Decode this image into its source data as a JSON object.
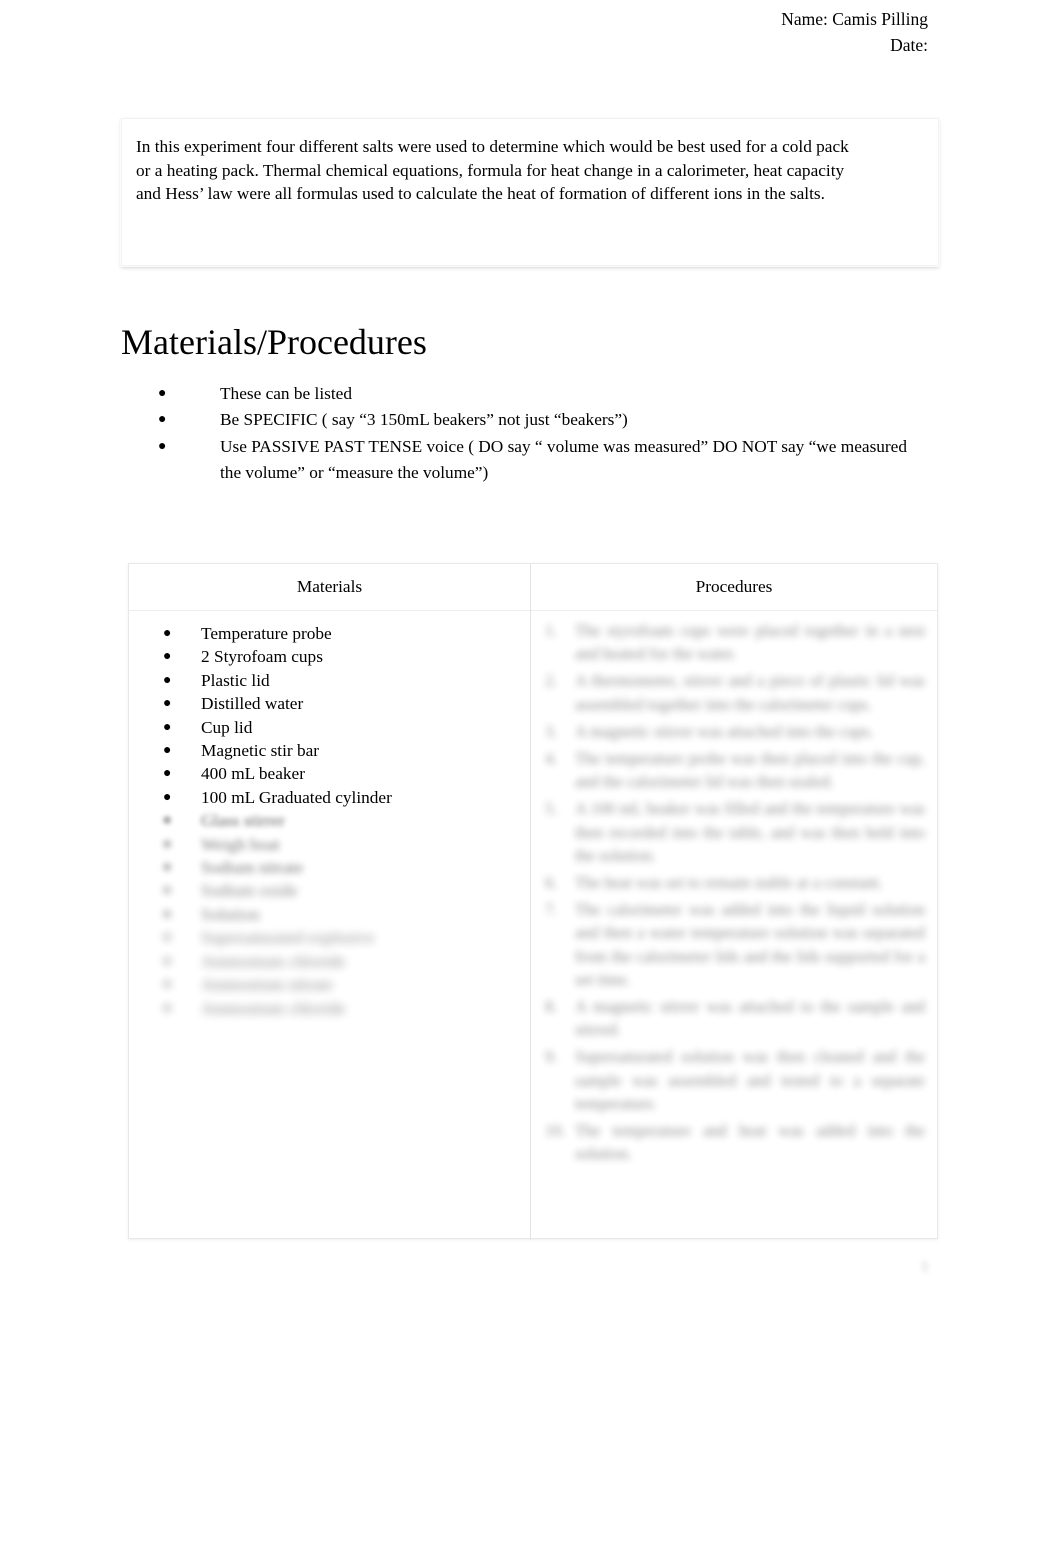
{
  "header": {
    "name_line": "Name: Camis Pilling",
    "date_line": "Date:"
  },
  "abstract": {
    "text": "In this experiment four different salts were used to determine which would be best used for a cold pack or a heating pack. Thermal chemical equations, formula for heat change in a calorimeter, heat capacity and Hess’ law were all formulas used to calculate the heat of formation of different ions in the salts."
  },
  "section": {
    "title": "Materials/Procedures"
  },
  "instructions": {
    "bullet_glyph": "●",
    "items": [
      "These can be listed",
      "Be SPECIFIC ( say “3 150mL beakers” not just “beakers”)",
      "Use PASSIVE PAST TENSE voice ( DO say “ volume was measured” DO NOT say “we measured the volume” or “measure the volume”)"
    ]
  },
  "table": {
    "headers": {
      "materials": "Materials",
      "procedures": "Procedures"
    },
    "bullet_glyph": "●",
    "materials": [
      {
        "text": "Temperature probe",
        "redact": 0
      },
      {
        "text": "2 Styrofoam cups",
        "redact": 0
      },
      {
        "text": "Plastic lid",
        "redact": 0
      },
      {
        "text": "Distilled water",
        "redact": 0
      },
      {
        "text": "Cup lid",
        "redact": 0
      },
      {
        "text": "Magnetic stir bar",
        "redact": 0
      },
      {
        "text": "400 mL beaker",
        "redact": 0
      },
      {
        "text": "100 mL Graduated cylinder",
        "redact": 0
      },
      {
        "text": "Glass stirrer",
        "redact": 1
      },
      {
        "text": "Weigh boat",
        "redact": 2
      },
      {
        "text": "Sodium nitrate",
        "redact": 2
      },
      {
        "text": "Sodium oxide",
        "redact": 3
      },
      {
        "text": "Solution",
        "redact": 3
      },
      {
        "text": "Supersaturated explosive",
        "redact": 4
      },
      {
        "text": "Ammonium chloride",
        "redact": 4
      },
      {
        "text": "Ammonium nitrate",
        "redact": 4
      },
      {
        "text": "Ammonium chloride",
        "redact": 4
      }
    ],
    "procedures": [
      {
        "number": "1.",
        "text": "The styrofoam cups were placed together in a nest and heated for the water."
      },
      {
        "number": "2.",
        "text": "A thermometer, stirrer and a piece of plastic lid was assembled together into the calorimeter cups."
      },
      {
        "number": "3.",
        "text": "A magnetic stirrer was attached into the cups."
      },
      {
        "number": "4.",
        "text": "The temperature probe was then placed into the cup, and the calorimeter lid was then sealed."
      },
      {
        "number": "5.",
        "text": "A 100 mL beaker was filled and the temperature was then recorded into the table, and was then held into the solution."
      },
      {
        "number": "6.",
        "text": "The heat was set to remain stable at a constant."
      },
      {
        "number": "7.",
        "text": "The calorimeter was added into the liquid solution and then a water temperature solution was separated from the calorimeter lids and the lids supported for a set time."
      },
      {
        "number": "8.",
        "text": "A magnetic stirrer was attached to the sample and stirred."
      },
      {
        "number": "9.",
        "text": "Supersaturated solution was then cleaned and the sample was assembled and tested to a separate temperature."
      },
      {
        "number": "10.",
        "text": "The temperature and heat was added into the solution."
      }
    ]
  },
  "page_number": "1"
}
